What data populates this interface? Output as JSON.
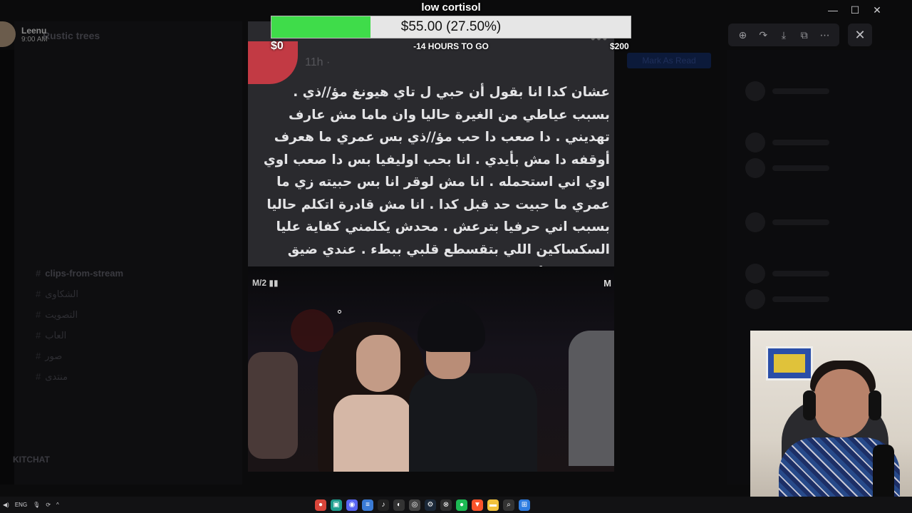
{
  "discord": {
    "server_name": "Rustic trees",
    "user_panel_name": "KITCHAT",
    "mark_as_read": "Mark As Read",
    "channels": [
      {
        "name": "clips-from-stream",
        "bright": true
      },
      {
        "name": "الشكاوى",
        "bright": false
      },
      {
        "name": "التصويت",
        "bright": false
      },
      {
        "name": "العاب",
        "bright": false
      },
      {
        "name": "صور",
        "bright": false
      },
      {
        "name": "منتدى",
        "bright": false
      }
    ]
  },
  "streamer": {
    "name": "Leenu",
    "time": "9:00 AM"
  },
  "window_controls": {
    "minimize": "—",
    "maximize": "☐",
    "close": "✕"
  },
  "viewer_toolbar": {
    "icons": [
      "zoom-in-icon",
      "share-icon",
      "download-icon",
      "open-external-icon",
      "more-icon"
    ],
    "glyphs": [
      "⊕",
      "↷",
      "⤓",
      "⧉",
      "⋯"
    ],
    "close_glyph": "✕"
  },
  "post": {
    "time": "11h · ",
    "more": "•••",
    "arabic_text": "عشان كدا انا بقول أن حبي ل تاي هيونغ مؤ//ذي . بسبب عياطي من الغيرة حاليا وان ماما مش عارف تهديني . دا صعب دا حب مؤ//ذي بس عمري ما هعرف أوقفه دا مش بأيدي . انا بحب اوليفيا بس دا صعب اوي اوي اني استحمله . انا مش لوقر انا بس حبيته زي ما عمري ما حبيت حد قبل كدا . انا مش قادرة اتكلم حاليا بسبب اني حرفيا بترعش . محدش يكلمني كفاية عليا السكساكين اللي بتقسطع قلبي ببطء . عندي ضيق تنفس بجماعة.",
    "video_logo_left": "M/2 ▮▮",
    "video_logo_right": "M"
  },
  "goal": {
    "title": "low cortisol",
    "amount": "$55.00 (27.50%)",
    "progress": 0.275,
    "start": "$0",
    "end": "$200",
    "remaining": "-14 HOURS TO GO"
  },
  "taskbar": {
    "language": "ENG",
    "apps": [
      {
        "name": "chrome",
        "color": "#d9453a",
        "glyph": "●"
      },
      {
        "name": "app-teal",
        "color": "#1f9e8e",
        "glyph": "▣"
      },
      {
        "name": "discord",
        "color": "#5865f2",
        "glyph": "◉"
      },
      {
        "name": "notepad",
        "color": "#3a7bd5",
        "glyph": "≡"
      },
      {
        "name": "tiktok",
        "color": "#222",
        "glyph": "♪"
      },
      {
        "name": "github",
        "color": "#333",
        "glyph": "◐"
      },
      {
        "name": "obs",
        "color": "#444",
        "glyph": "◎"
      },
      {
        "name": "steam",
        "color": "#1b2838",
        "glyph": "⚙"
      },
      {
        "name": "xbox",
        "color": "#2d2d2d",
        "glyph": "⊗"
      },
      {
        "name": "spotify",
        "color": "#1db954",
        "glyph": "●"
      },
      {
        "name": "brave",
        "color": "#fb542b",
        "glyph": "▼"
      },
      {
        "name": "explorer",
        "color": "#f2c23c",
        "glyph": "▬"
      },
      {
        "name": "search",
        "color": "#333",
        "glyph": "⌕"
      },
      {
        "name": "start",
        "color": "#2f7de1",
        "glyph": "⊞"
      }
    ]
  }
}
